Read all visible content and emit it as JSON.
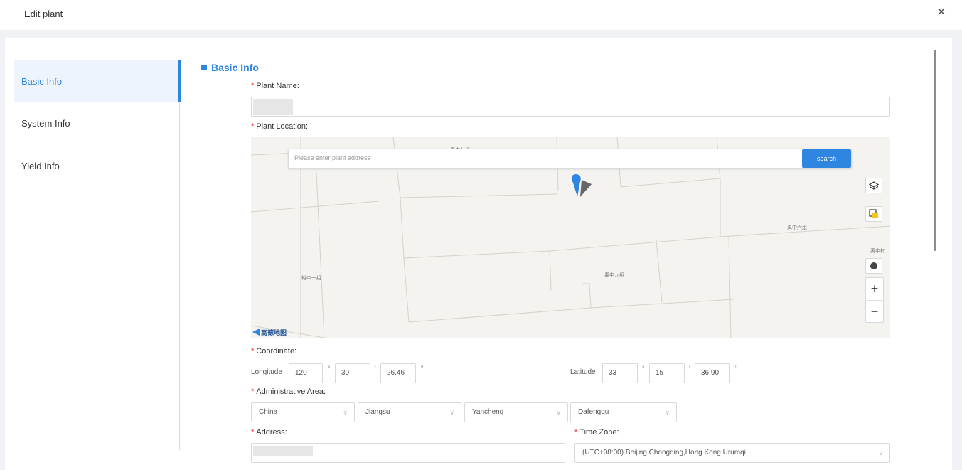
{
  "header": {
    "title": "Edit plant",
    "close_glyph": "✕",
    "close_icon": "close-icon"
  },
  "sidebar": {
    "items": [
      {
        "label": "Basic Info",
        "active": true
      },
      {
        "label": "System Info",
        "active": false
      },
      {
        "label": "Yield Info",
        "active": false
      }
    ]
  },
  "section": {
    "title": "Basic Info"
  },
  "form": {
    "required_mark": "*",
    "plant_name_label": "Plant Name:",
    "plant_location_label": "Plant Location:",
    "coordinate_label": "Coordinate:",
    "admin_area_label": "Administrative Area:",
    "address_label": "Address:",
    "timezone_label": "Time Zone:",
    "timezone_value": "(UTC+08:00) Beijing,Chongqing,Hong Kong,Urumqi"
  },
  "map": {
    "search_placeholder": "Please enter plant address",
    "search_button": "search",
    "places": [
      "禹中七组",
      "禹中六组",
      "禹中村",
      "禹中九组",
      "裕中一组"
    ],
    "logo_text": "高德地图",
    "icons": [
      "location-pin-icon",
      "layers-icon",
      "satellite-icon",
      "locate-icon",
      "zoom-in-icon",
      "zoom-out-icon"
    ],
    "zoom_in": "+",
    "zoom_out": "−",
    "accent": "#2f86e0"
  },
  "coordinate": {
    "longitude_label": "Longitude",
    "latitude_label": "Latitude",
    "longitude": {
      "deg": "120",
      "min": "30",
      "sec": "26.46"
    },
    "latitude": {
      "deg": "33",
      "min": "15",
      "sec": "36.90"
    },
    "deg_symbol": "°",
    "min_symbol": "'",
    "sec_symbol": "\""
  },
  "admin_area": {
    "country": "China",
    "province": "Jiangsu",
    "city": "Yancheng",
    "district": "Dafengqu",
    "chevron": "∨"
  },
  "colors": {
    "accent": "#2f86e0",
    "required": "#f5222d",
    "sidebar_active_bg": "#eef4fc"
  }
}
